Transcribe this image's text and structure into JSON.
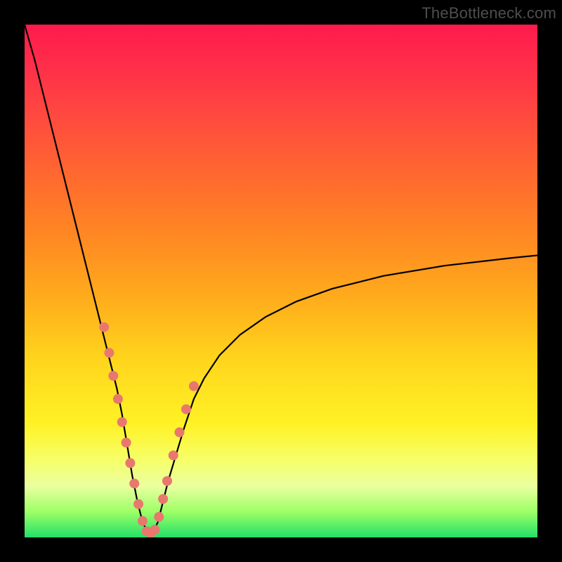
{
  "watermark_text": "TheBottleneck.com",
  "chart_data": {
    "type": "line",
    "title": "",
    "xlabel": "",
    "ylabel": "",
    "xlim_normalized": [
      0,
      100
    ],
    "ylim_normalized": [
      0,
      100
    ],
    "legend_position": "none",
    "grid": false,
    "background": "red-to-green-vertical-gradient",
    "series": [
      {
        "name": "bottleneck-curve",
        "description": "V-shaped valley curve; y=100 at left edge, minimum near x≈24, rising toward y≈55 at right edge",
        "xy_points_normalized": [
          [
            0,
            100
          ],
          [
            2,
            93
          ],
          [
            4,
            85
          ],
          [
            6,
            77
          ],
          [
            8,
            69
          ],
          [
            10,
            61
          ],
          [
            12,
            53
          ],
          [
            14,
            45
          ],
          [
            16,
            37
          ],
          [
            18,
            29
          ],
          [
            19,
            24
          ],
          [
            20,
            18
          ],
          [
            21,
            12
          ],
          [
            22,
            7
          ],
          [
            23,
            3
          ],
          [
            24,
            1
          ],
          [
            25,
            1
          ],
          [
            26,
            3
          ],
          [
            27,
            7
          ],
          [
            28,
            11
          ],
          [
            29.5,
            16
          ],
          [
            31,
            21
          ],
          [
            33,
            27
          ],
          [
            35,
            31
          ],
          [
            38,
            35.5
          ],
          [
            42,
            39.5
          ],
          [
            47,
            43
          ],
          [
            53,
            46
          ],
          [
            60,
            48.5
          ],
          [
            70,
            51
          ],
          [
            82,
            53
          ],
          [
            95,
            54.5
          ],
          [
            100,
            55
          ]
        ]
      }
    ],
    "highlight_dots": {
      "description": "salmon-colored markers along the lower portion of the curve",
      "xy_points_normalized": [
        [
          15.5,
          41
        ],
        [
          16.5,
          36
        ],
        [
          17.3,
          31.5
        ],
        [
          18.2,
          27
        ],
        [
          19,
          22.5
        ],
        [
          19.8,
          18.5
        ],
        [
          20.6,
          14.5
        ],
        [
          21.4,
          10.5
        ],
        [
          22.2,
          6.5
        ],
        [
          23,
          3.2
        ],
        [
          23.8,
          1.2
        ],
        [
          24.6,
          0.8
        ],
        [
          25.4,
          1.5
        ],
        [
          26.2,
          4
        ],
        [
          27,
          7.5
        ],
        [
          27.8,
          11
        ],
        [
          29,
          16
        ],
        [
          30.2,
          20.5
        ],
        [
          31.5,
          25
        ],
        [
          33,
          29.5
        ]
      ],
      "dot_radius_px": 7,
      "dot_color": "#e8786e"
    }
  }
}
